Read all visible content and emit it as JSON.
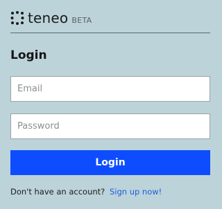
{
  "header": {
    "brand": "teneo",
    "badge": "BETA",
    "logo_icon": "teneo-logo-icon"
  },
  "form": {
    "title": "Login",
    "email": {
      "value": "",
      "placeholder": "Email"
    },
    "password": {
      "value": "",
      "placeholder": "Password"
    },
    "submit_label": "Login"
  },
  "footer": {
    "prompt": "Don't have an account?",
    "signup_link": "Sign up now!"
  },
  "colors": {
    "background": "#bcd3d9",
    "accent": "#0d4cff",
    "link": "#1f5ce0"
  }
}
